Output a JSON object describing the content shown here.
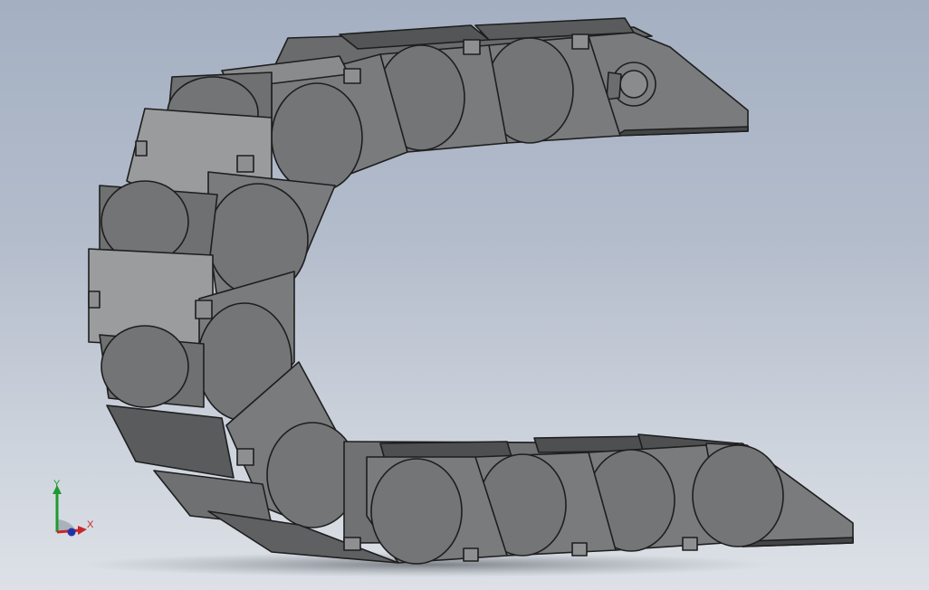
{
  "viewport": {
    "model": "cable-carrier-chain",
    "background_top": "#a4b0c2",
    "background_bottom": "#dde1e7"
  },
  "part_colors": {
    "surface": "#7a7b7d",
    "surface_light": "#9a9b9d",
    "surface_dark": "#555658",
    "edge": "#1e1e1e"
  },
  "triad": {
    "y_label": "Y",
    "x_label": "X",
    "y_color": "#1f9a2e",
    "x_color": "#c62828",
    "z_color": "#2233aa"
  }
}
